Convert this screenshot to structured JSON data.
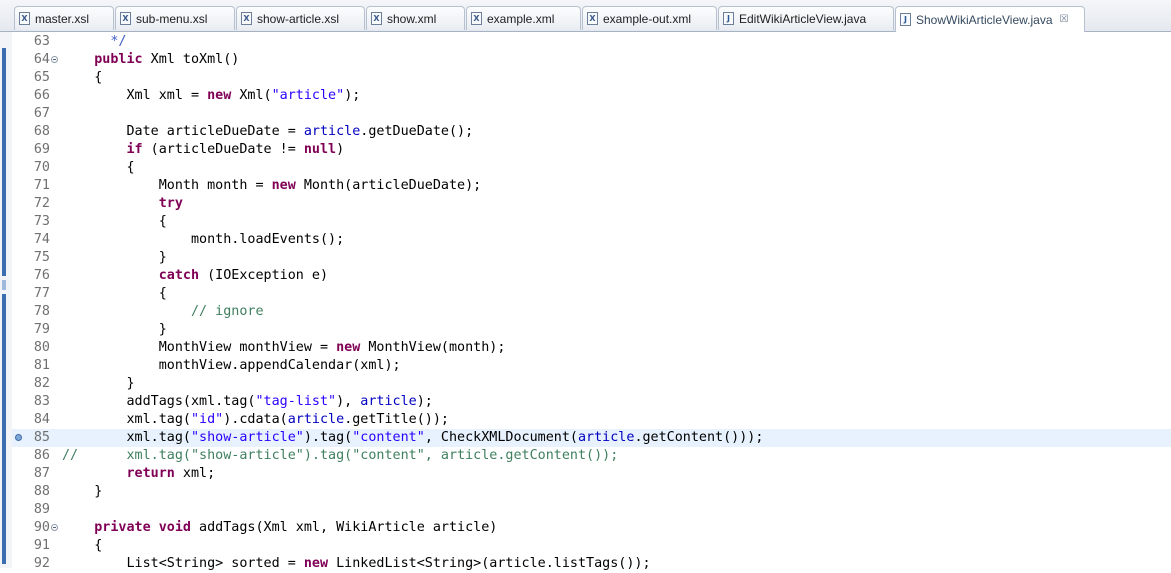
{
  "tabs": [
    {
      "label": "master.xsl",
      "icon": "xml-file-icon",
      "active": false
    },
    {
      "label": "sub-menu.xsl",
      "icon": "xml-file-icon",
      "active": false
    },
    {
      "label": "show-article.xsl",
      "icon": "xml-file-icon",
      "active": false
    },
    {
      "label": "show.xml",
      "icon": "xml-file-icon",
      "active": false
    },
    {
      "label": "example.xml",
      "icon": "xml-file-icon",
      "active": false
    },
    {
      "label": "example-out.xml",
      "icon": "xml-file-icon",
      "active": false
    },
    {
      "label": "EditWikiArticleView.java",
      "icon": "java-file-icon",
      "active": false
    },
    {
      "label": "ShowWikiArticleView.java",
      "icon": "java-file-icon",
      "active": true,
      "close": "☒"
    }
  ],
  "colors": {
    "keyword": "#7f0055",
    "string": "#2a00ff",
    "field": "#0000c0",
    "comment": "#3f7f5f",
    "javadoc": "#3f5fbf",
    "current_line": "#e8f2fe"
  },
  "editor": {
    "lines": [
      {
        "n": "63",
        "tokens": [
          [
            "      */",
            "jdoc"
          ]
        ]
      },
      {
        "n": "64",
        "fold": true,
        "tokens": [
          [
            "    ",
            ""
          ],
          [
            "public",
            "kw"
          ],
          [
            " Xml toXml()",
            ""
          ]
        ]
      },
      {
        "n": "65",
        "tokens": [
          [
            "    {",
            ""
          ]
        ]
      },
      {
        "n": "66",
        "tokens": [
          [
            "        Xml xml = ",
            ""
          ],
          [
            "new",
            "kw"
          ],
          [
            " Xml(",
            ""
          ],
          [
            "\"article\"",
            "str"
          ],
          [
            ");",
            ""
          ]
        ]
      },
      {
        "n": "67",
        "tokens": []
      },
      {
        "n": "68",
        "tokens": [
          [
            "        Date articleDueDate = ",
            ""
          ],
          [
            "article",
            "fld"
          ],
          [
            ".getDueDate();",
            ""
          ]
        ]
      },
      {
        "n": "69",
        "tokens": [
          [
            "        ",
            ""
          ],
          [
            "if",
            "kw"
          ],
          [
            " (articleDueDate != ",
            ""
          ],
          [
            "null",
            "kw"
          ],
          [
            ")",
            ""
          ]
        ]
      },
      {
        "n": "70",
        "tokens": [
          [
            "        {",
            ""
          ]
        ]
      },
      {
        "n": "71",
        "tokens": [
          [
            "            Month month = ",
            ""
          ],
          [
            "new",
            "kw"
          ],
          [
            " Month(articleDueDate);",
            ""
          ]
        ]
      },
      {
        "n": "72",
        "tokens": [
          [
            "            ",
            ""
          ],
          [
            "try",
            "kw"
          ]
        ]
      },
      {
        "n": "73",
        "tokens": [
          [
            "            {",
            ""
          ]
        ]
      },
      {
        "n": "74",
        "tokens": [
          [
            "                month.loadEvents();",
            ""
          ]
        ]
      },
      {
        "n": "75",
        "tokens": [
          [
            "            }",
            ""
          ]
        ]
      },
      {
        "n": "76",
        "tokens": [
          [
            "            ",
            ""
          ],
          [
            "catch",
            "kw"
          ],
          [
            " (IOException e)",
            ""
          ]
        ]
      },
      {
        "n": "77",
        "tokens": [
          [
            "            {",
            ""
          ]
        ]
      },
      {
        "n": "78",
        "tokens": [
          [
            "                ",
            ""
          ],
          [
            "// ignore",
            "cmt"
          ]
        ]
      },
      {
        "n": "79",
        "tokens": [
          [
            "            }",
            ""
          ]
        ]
      },
      {
        "n": "80",
        "tokens": [
          [
            "            MonthView monthView = ",
            ""
          ],
          [
            "new",
            "kw"
          ],
          [
            " MonthView(month);",
            ""
          ]
        ]
      },
      {
        "n": "81",
        "tokens": [
          [
            "            monthView.appendCalendar(xml);",
            ""
          ]
        ]
      },
      {
        "n": "82",
        "tokens": [
          [
            "        }",
            ""
          ]
        ]
      },
      {
        "n": "83",
        "tokens": [
          [
            "        addTags(xml.tag(",
            ""
          ],
          [
            "\"tag-list\"",
            "str"
          ],
          [
            "), ",
            ""
          ],
          [
            "article",
            "fld"
          ],
          [
            ");",
            ""
          ]
        ]
      },
      {
        "n": "84",
        "tokens": [
          [
            "        xml.tag(",
            ""
          ],
          [
            "\"id\"",
            "str"
          ],
          [
            ").cdata(",
            ""
          ],
          [
            "article",
            "fld"
          ],
          [
            ".getTitle());",
            ""
          ]
        ]
      },
      {
        "n": "85",
        "current": true,
        "breakpoint": true,
        "tokens": [
          [
            "        xml.tag(",
            ""
          ],
          [
            "\"show-article\"",
            "str"
          ],
          [
            ").tag(",
            ""
          ],
          [
            "\"content\"",
            "str"
          ],
          [
            ", CheckXMLDocument(",
            ""
          ],
          [
            "article",
            "fld"
          ],
          [
            ".getContent()));",
            ""
          ]
        ]
      },
      {
        "n": "86",
        "tokens": [
          [
            "//      xml.tag(\"show-article\").tag(\"content\", article.getContent());",
            "cmt"
          ]
        ]
      },
      {
        "n": "87",
        "tokens": [
          [
            "        ",
            ""
          ],
          [
            "return",
            "kw"
          ],
          [
            " xml;",
            ""
          ]
        ]
      },
      {
        "n": "88",
        "tokens": [
          [
            "    }",
            ""
          ]
        ]
      },
      {
        "n": "89",
        "tokens": []
      },
      {
        "n": "90",
        "fold": true,
        "tokens": [
          [
            "    ",
            ""
          ],
          [
            "private",
            "kw"
          ],
          [
            " ",
            ""
          ],
          [
            "void",
            "kw"
          ],
          [
            " addTags(Xml xml, WikiArticle article)",
            ""
          ]
        ]
      },
      {
        "n": "91",
        "tokens": [
          [
            "    {",
            ""
          ]
        ]
      },
      {
        "n": "92",
        "tokens": [
          [
            "        List<String> sorted = ",
            ""
          ],
          [
            "new",
            "kw"
          ],
          [
            " LinkedList<String>(article.listTags());",
            ""
          ]
        ]
      }
    ]
  }
}
